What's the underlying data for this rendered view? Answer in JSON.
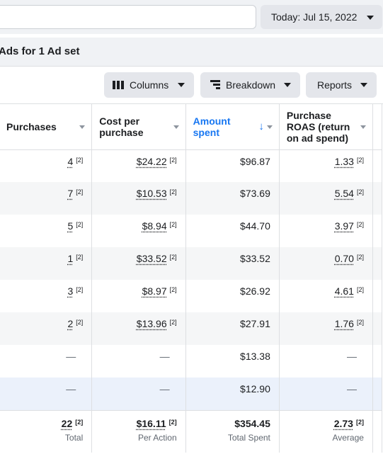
{
  "topbar": {
    "search_placeholder": "",
    "date_label": "Today: Jul 15, 2022"
  },
  "ads_header": "Ads for 1 Ad set",
  "toolbar": {
    "columns": "Columns",
    "breakdown": "Breakdown",
    "reports": "Reports"
  },
  "table": {
    "headers": {
      "purchases": "Purchases",
      "cost": "Cost per\npurchase",
      "amount": "Amount\nspent",
      "roas": "Purchase\nROAS (return\non ad spend)"
    },
    "sort_arrow": "↓",
    "ref": "[2]",
    "dash": "—",
    "rows": [
      {
        "purchases": "4",
        "cost": "$24.22",
        "amount": "$96.87",
        "roas": "1.33"
      },
      {
        "purchases": "7",
        "cost": "$10.53",
        "amount": "$73.69",
        "roas": "5.54"
      },
      {
        "purchases": "5",
        "cost": "$8.94",
        "amount": "$44.70",
        "roas": "3.97"
      },
      {
        "purchases": "1",
        "cost": "$33.52",
        "amount": "$33.52",
        "roas": "0.70"
      },
      {
        "purchases": "3",
        "cost": "$8.97",
        "amount": "$26.92",
        "roas": "4.61"
      },
      {
        "purchases": "2",
        "cost": "$13.96",
        "amount": "$27.91",
        "roas": "1.76"
      },
      {
        "purchases": "—",
        "cost": "—",
        "amount": "$13.38",
        "roas": "—"
      },
      {
        "purchases": "—",
        "cost": "—",
        "amount": "$12.90",
        "roas": "—"
      }
    ],
    "totals": {
      "purchases": {
        "value": "22",
        "label": "Total"
      },
      "cost": {
        "value": "$16.11",
        "label": "Per Action"
      },
      "amount": {
        "value": "$354.45",
        "label": "Total Spent"
      },
      "roas": {
        "value": "2.73",
        "label": "Average"
      }
    }
  }
}
